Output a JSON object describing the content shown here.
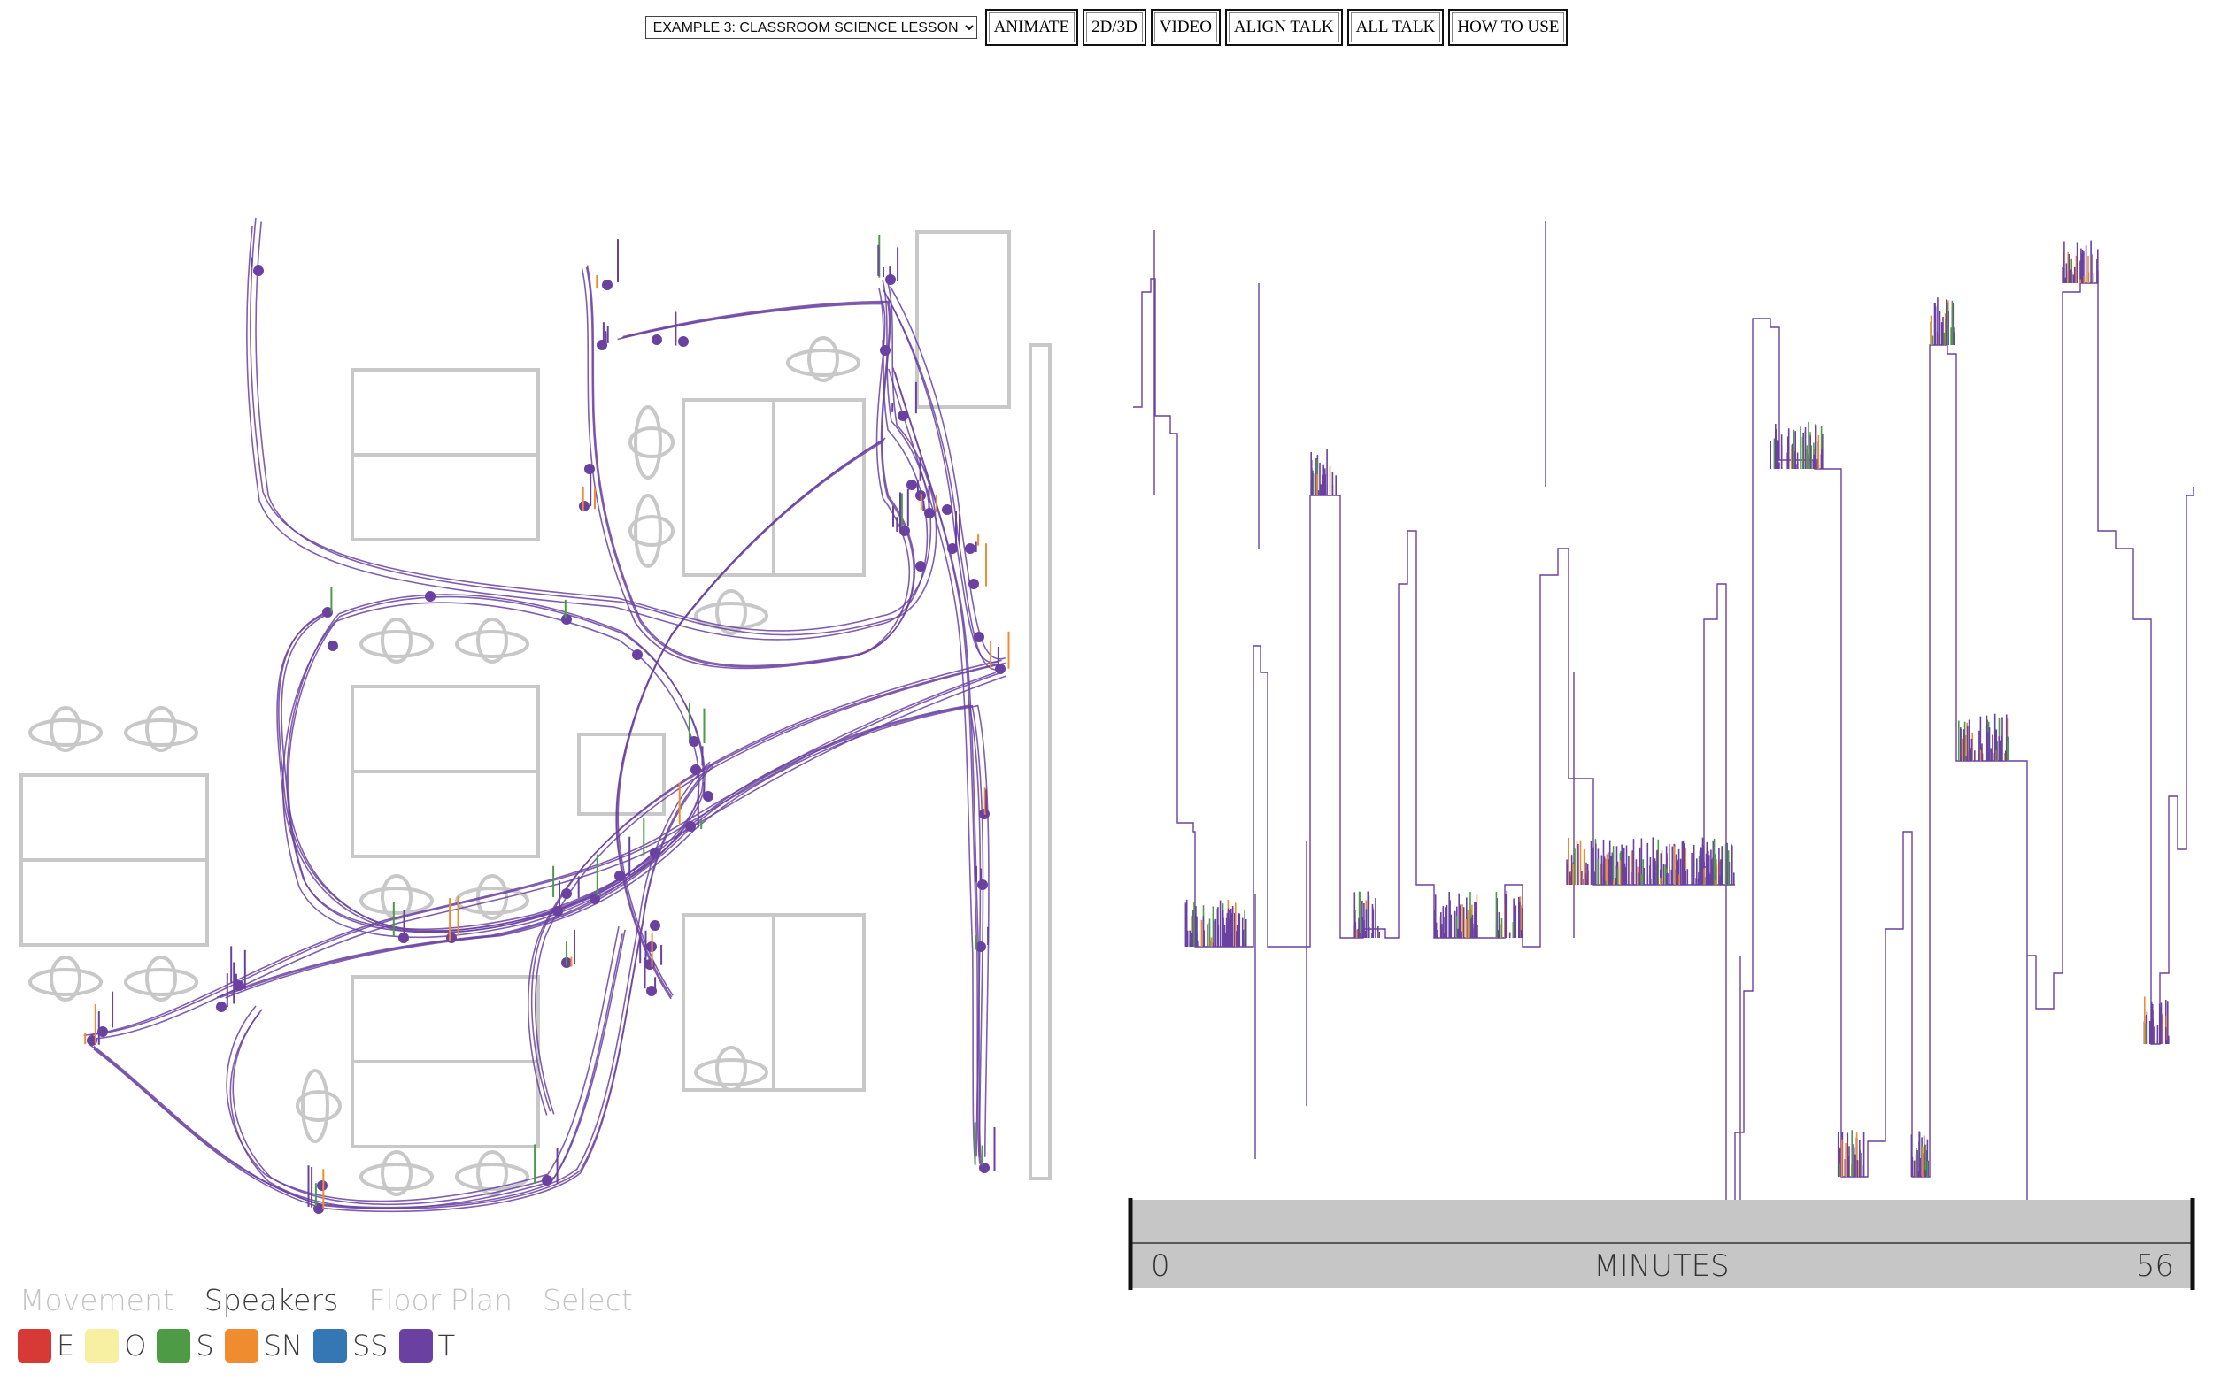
{
  "toolbar": {
    "example_select": "EXAMPLE 3: CLASSROOM SCIENCE LESSON",
    "buttons": [
      "ANIMATE",
      "2D/3D",
      "VIDEO",
      "ALIGN TALK",
      "ALL TALK",
      "HOW TO USE"
    ]
  },
  "timeline": {
    "start_label": "0",
    "end_label": "56",
    "axis_label": "MINUTES"
  },
  "tabs": [
    {
      "label": "Movement",
      "active": false
    },
    {
      "label": "Speakers",
      "active": true
    },
    {
      "label": "Floor Plan",
      "active": false
    },
    {
      "label": "Select",
      "active": false
    }
  ],
  "speakers": [
    {
      "code": "E",
      "color": "#d73a34"
    },
    {
      "code": "O",
      "color": "#f7f0a3"
    },
    {
      "code": "S",
      "color": "#4e9b45"
    },
    {
      "code": "SN",
      "color": "#ef8c30"
    },
    {
      "code": "SS",
      "color": "#3576b5"
    },
    {
      "code": "T",
      "color": "#6a41a0"
    }
  ],
  "colors": {
    "path": "#6a41a0",
    "furniture": "#c8c8c8",
    "timeline_bar": "#c6c6c6"
  }
}
